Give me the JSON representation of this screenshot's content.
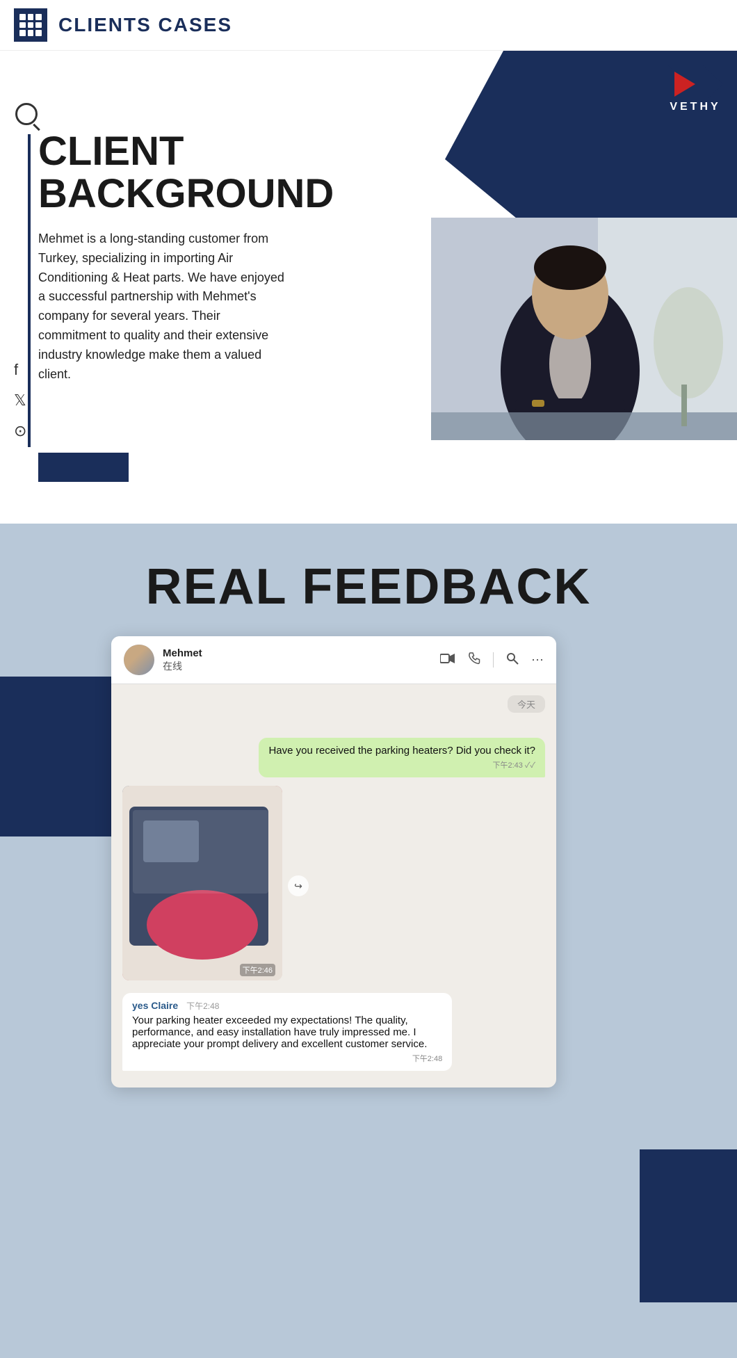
{
  "header": {
    "title": "CLIENTS CASES"
  },
  "section1": {
    "title_line1": "CLIENT",
    "title_line2": "BACKGROUND",
    "description": "Mehmet is a long-standing customer from Turkey, specializing in importing Air Conditioning & Heat parts. We have enjoyed a successful partnership with Mehmet's company for several years. Their commitment to quality and their extensive industry knowledge make them a valued client.",
    "logo_text": "VETHY",
    "social": {
      "facebook": "f",
      "twitter": "𝕏",
      "instagram": "⊙"
    }
  },
  "section2": {
    "title": "REAL FEEDBACK",
    "chat": {
      "status": "在线",
      "date_label": "今天",
      "msg_sent_text": "Have you received the parking heaters? Did you check it?",
      "msg_sent_time": "下午2:43",
      "img_time": "下午2:46",
      "msg_received_sender": "yes Claire",
      "msg_received_sender_time": "下午2:48",
      "msg_received_text": "Your parking heater exceeded my expectations! The quality, performance, and easy installation have truly impressed me. I appreciate your prompt delivery and excellent customer service.",
      "msg_received_time": "下午2:48"
    }
  }
}
